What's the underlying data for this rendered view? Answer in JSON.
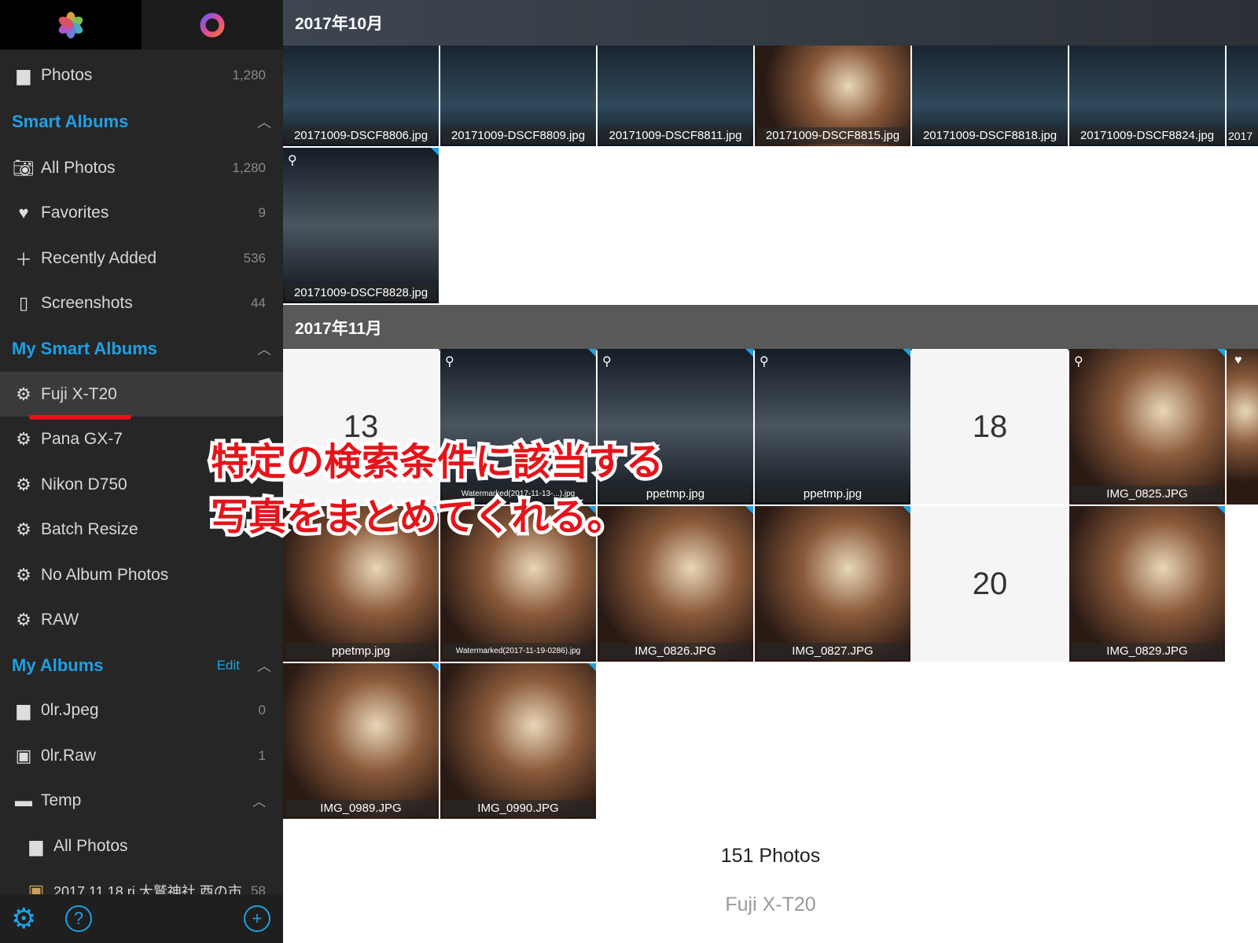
{
  "sidebar": {
    "library": {
      "label": "Photos",
      "count": "1,280"
    },
    "smart_albums": {
      "title": "Smart Albums",
      "items": [
        {
          "label": "All Photos",
          "count": "1,280",
          "icon": "camera-icon"
        },
        {
          "label": "Favorites",
          "count": "9",
          "icon": "heart-icon"
        },
        {
          "label": "Recently Added",
          "count": "536",
          "icon": "plus-icon"
        },
        {
          "label": "Screenshots",
          "count": "44",
          "icon": "phone-icon"
        }
      ]
    },
    "my_smart_albums": {
      "title": "My Smart Albums",
      "items": [
        {
          "label": "Fuji X-T20",
          "selected": true
        },
        {
          "label": "Pana GX-7"
        },
        {
          "label": "Nikon D750"
        },
        {
          "label": "Batch Resize"
        },
        {
          "label": "No Album Photos"
        },
        {
          "label": "RAW"
        }
      ]
    },
    "my_albums": {
      "title": "My Albums",
      "edit": "Edit",
      "items": [
        {
          "label": "0lr.Jpeg",
          "count": "0"
        },
        {
          "label": "0lr.Raw",
          "count": "1"
        },
        {
          "label": "Temp"
        },
        {
          "label": "All Photos"
        },
        {
          "label": "2017.11.18 ri 大鷲神社 酉の市",
          "count": "58"
        }
      ]
    }
  },
  "main": {
    "oct": {
      "title": "2017年10月",
      "row1": [
        "20171009-DSCF8806.jpg",
        "20171009-DSCF8809.jpg",
        "20171009-DSCF8811.jpg",
        "20171009-DSCF8815.jpg",
        "20171009-DSCF8818.jpg",
        "20171009-DSCF8824.jpg",
        "2017"
      ],
      "row2": [
        "20171009-DSCF8828.jpg"
      ]
    },
    "nov": {
      "title": "2017年11月",
      "row1": [
        {
          "date": "13"
        },
        {
          "name": "Watermarked(2017-11-13-...).jpg"
        },
        {
          "name": "ppetmp.jpg"
        },
        {
          "name": "ppetmp.jpg"
        },
        {
          "date": "18"
        },
        {
          "name": "IMG_0825.JPG"
        }
      ],
      "row2": [
        {
          "name": "ppetmp.jpg"
        },
        {
          "name": "Watermarked(2017-11-19-0286).jpg"
        },
        {
          "name": "IMG_0826.JPG"
        },
        {
          "name": "IMG_0827.JPG"
        },
        {
          "date": "20"
        },
        {
          "name": "IMG_0829.JPG"
        }
      ],
      "row3": [
        {
          "name": "IMG_0989.JPG"
        },
        {
          "name": "IMG_0990.JPG"
        }
      ]
    },
    "footer": {
      "count": "151 Photos",
      "album": "Fuji X-T20"
    }
  },
  "overlay": {
    "line1": "特定の検索条件に該当する",
    "line2": "写真をまとめてくれる。"
  },
  "colors": {
    "accent": "#1ea0e6",
    "annotation": "#e5141b"
  }
}
